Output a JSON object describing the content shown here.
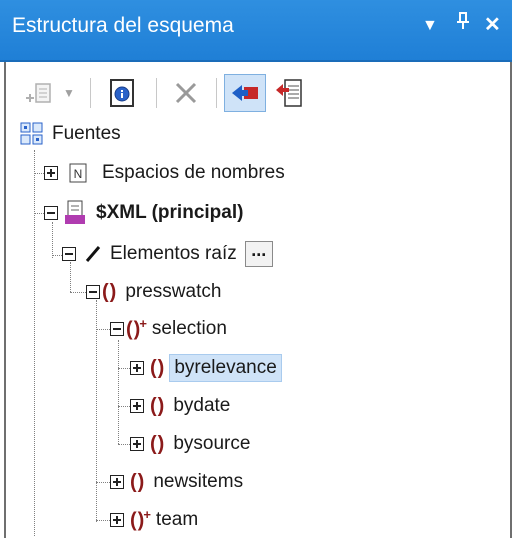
{
  "window": {
    "title": "Estructura del esquema",
    "accent": "#1f7fd6"
  },
  "titlebar_buttons": {
    "dropdown": "▼",
    "pin": "ᵖ",
    "close": "✕"
  },
  "tree": {
    "root": "Fuentes",
    "namespaces": "Espacios de nombres",
    "xml_source": "$XML (principal)",
    "root_elements": "Elementos raíz",
    "dots": "...",
    "presswatch": "presswatch",
    "selection": "selection",
    "byrelevance": "byrelevance",
    "bydate": "bydate",
    "bysource": "bysource",
    "newsitems": "newsitems",
    "team": "team"
  }
}
